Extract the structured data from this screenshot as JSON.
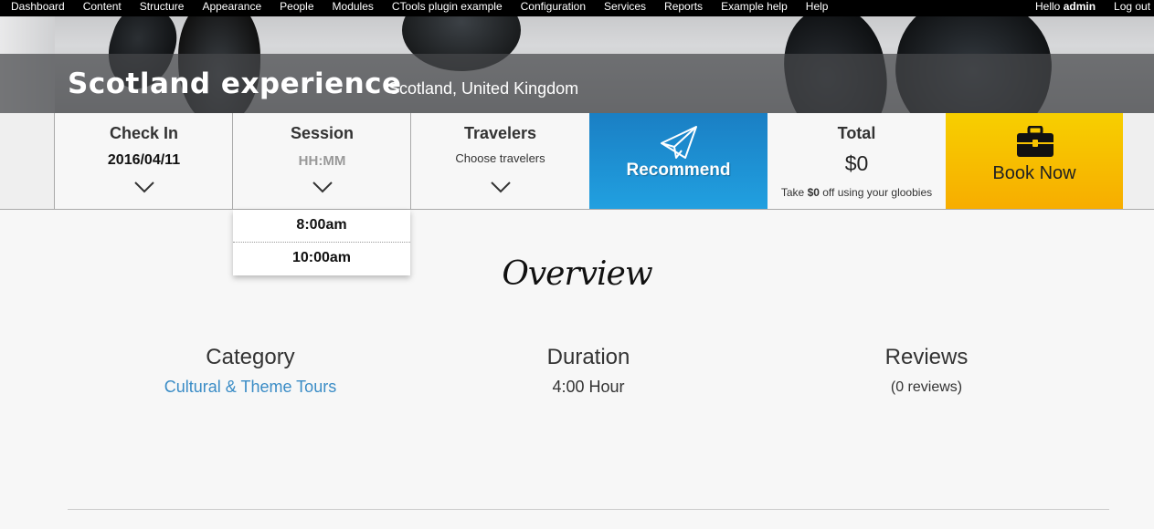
{
  "admin_bar": {
    "menu": [
      "Dashboard",
      "Content",
      "Structure",
      "Appearance",
      "People",
      "Modules",
      "CTools plugin example",
      "Configuration",
      "Services",
      "Reports",
      "Example help",
      "Help"
    ],
    "hello_prefix": "Hello ",
    "username": "admin",
    "logout": "Log out"
  },
  "hero": {
    "title": "Scotland experience",
    "location": "Scotland, United Kingdom"
  },
  "booking": {
    "check_in": {
      "label": "Check In",
      "value": "2016/04/11"
    },
    "session": {
      "label": "Session",
      "placeholder": "HH:MM",
      "options": [
        "8:00am",
        "10:00am"
      ]
    },
    "travelers": {
      "label": "Travelers",
      "placeholder": "Choose travelers"
    },
    "recommend": {
      "label": "Recommend"
    },
    "total": {
      "label": "Total",
      "value": "$0",
      "note_prefix": "Take ",
      "note_amount": "$0",
      "note_suffix": " off using your gloobies"
    },
    "book_now": {
      "label": "Book Now"
    }
  },
  "overview": {
    "title": "Overview",
    "category": {
      "label": "Category",
      "value": "Cultural & Theme Tours"
    },
    "duration": {
      "label": "Duration",
      "value": "4:00 Hour"
    },
    "reviews": {
      "label": "Reviews",
      "value": "(0 reviews)"
    }
  },
  "colors": {
    "recommend": "#1a8fd2",
    "book_now": "#f7bd00",
    "link": "#3a8cc6"
  }
}
